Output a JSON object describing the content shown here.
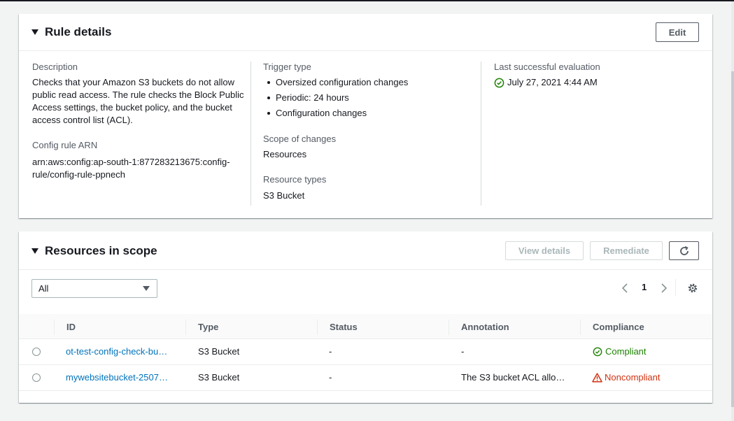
{
  "rule_details": {
    "title": "Rule details",
    "edit_label": "Edit",
    "description_label": "Description",
    "description_value": "Checks that your Amazon S3 buckets do not allow public read access. The rule checks the Block Public Access settings, the bucket policy, and the bucket access control list (ACL).",
    "description_lines": [
      "Checks that your Amazon S3 buckets do not allow",
      "public read access. The rule checks the Block Public",
      "Access settings, the bucket policy, and the bucket",
      "access control list (ACL)."
    ],
    "arn_label": "Config rule ARN",
    "arn_lines": [
      "arn:aws:config:ap-south-1:877283213675:config-",
      "rule/config-rule-ppnech"
    ],
    "trigger_label": "Trigger type",
    "trigger_items": [
      "Oversized configuration changes",
      "Periodic: 24 hours",
      "Configuration changes"
    ],
    "scope_label": "Scope of changes",
    "scope_value": "Resources",
    "resource_types_label": "Resource types",
    "resource_types_value": "S3 Bucket",
    "last_eval_label": "Last successful evaluation",
    "last_eval_value": "July 27, 2021 4:44 AM"
  },
  "resources": {
    "title": "Resources in scope",
    "view_details_label": "View details",
    "remediate_label": "Remediate",
    "filter_value": "All",
    "page_number": "1",
    "columns": [
      "ID",
      "Type",
      "Status",
      "Annotation",
      "Compliance"
    ],
    "rows": [
      {
        "id": "ot-test-config-check-bu…",
        "type": "S3 Bucket",
        "status": "-",
        "annotation": "-",
        "compliance": "Compliant"
      },
      {
        "id": "mywebsitebucket-2507…",
        "type": "S3 Bucket",
        "status": "-",
        "annotation": "The S3 bucket ACL allo…",
        "compliance": "Noncompliant"
      }
    ]
  },
  "colors": {
    "link": "#0073bb",
    "success": "#1d8102",
    "error": "#d13212",
    "background": "#f2f3f3"
  },
  "icons": {
    "collapse": "caret-down-icon",
    "refresh": "refresh-icon",
    "settings": "gear-icon",
    "prev": "chevron-left-icon",
    "next": "chevron-right-icon",
    "success": "check-circle-icon",
    "warning": "warning-triangle-icon"
  }
}
